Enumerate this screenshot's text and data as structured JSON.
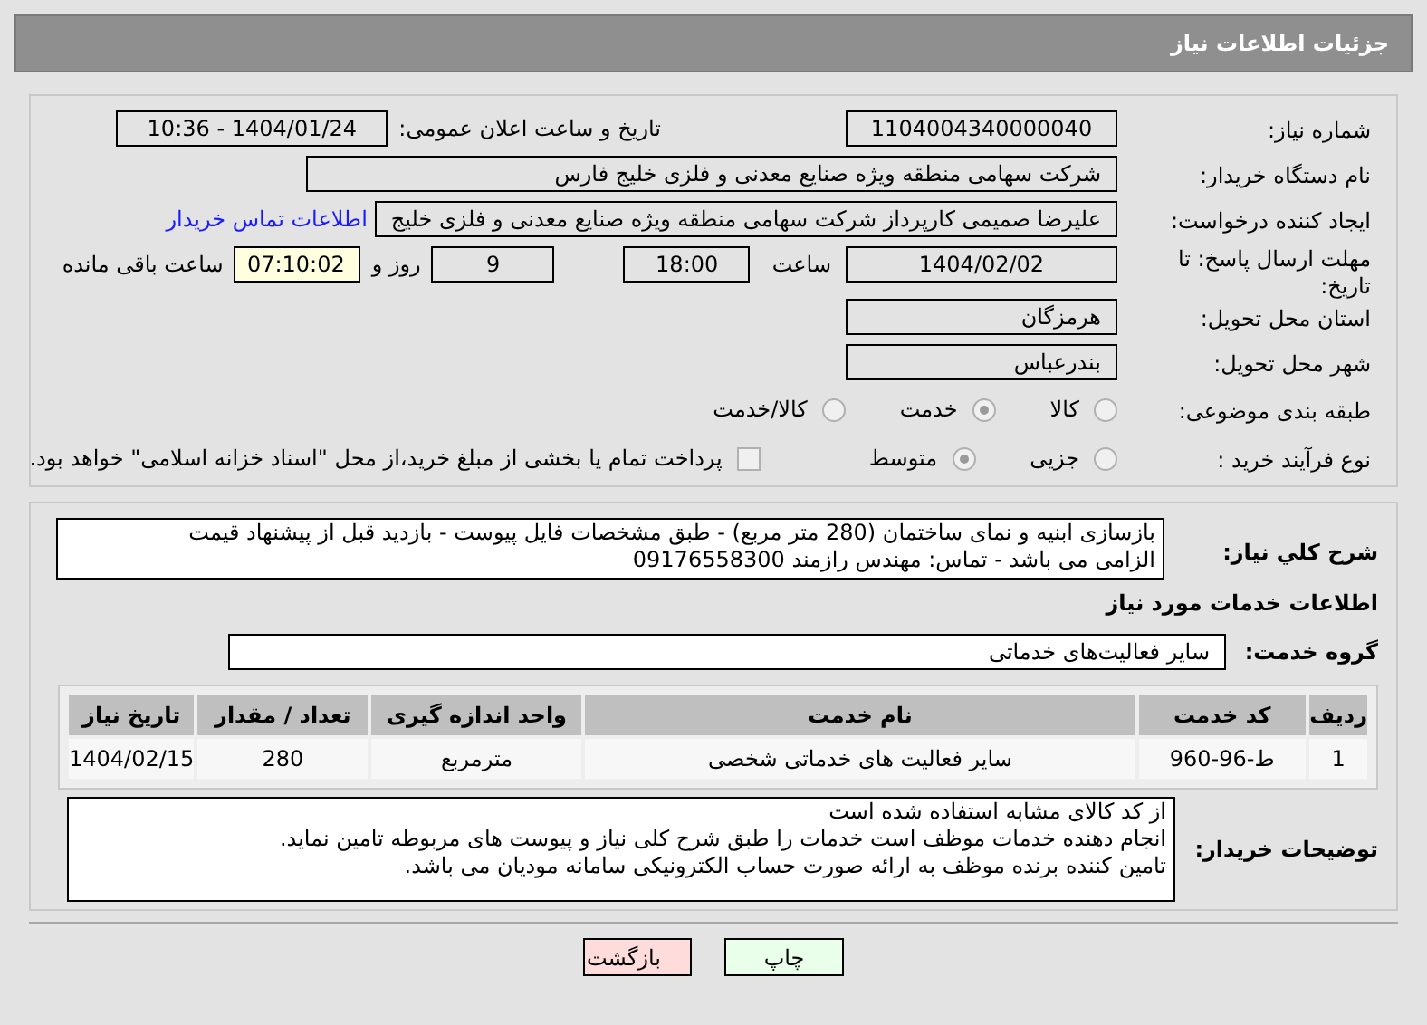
{
  "header": {
    "title": "جزئیات اطلاعات نیاز"
  },
  "need_number": {
    "label": "شماره نیاز:",
    "value": "1104004340000040"
  },
  "announce": {
    "label": "تاریخ و ساعت اعلان عمومی:",
    "value": "1404/01/24 - 10:36"
  },
  "buyer": {
    "label": "نام دستگاه خریدار:",
    "value": "شرکت سهامی منطقه ویژه صنایع معدنی و فلزی خلیج فارس"
  },
  "creator": {
    "label": "ایجاد کننده درخواست:",
    "value": "علیرضا صمیمی کارپرداز شرکت سهامی منطقه ویژه صنایع معدنی و فلزی خلیج",
    "link": "اطلاعات تماس خریدار"
  },
  "deadline": {
    "label": "مهلت ارسال پاسخ: تا تاریخ:",
    "date": "1404/02/02",
    "time_label": "ساعت",
    "time": "18:00",
    "days": "9",
    "days_label": "روز و",
    "remaining": "07:10:02",
    "remaining_label": "ساعت باقی مانده"
  },
  "province": {
    "label": "استان محل تحویل:",
    "value": "هرمزگان"
  },
  "city": {
    "label": "شهر محل تحویل:",
    "value": "بندرعباس"
  },
  "category": {
    "label": "طبقه بندی موضوعی:",
    "options": [
      {
        "label": "کالا",
        "selected": false
      },
      {
        "label": "خدمت",
        "selected": true
      },
      {
        "label": "کالا/خدمت",
        "selected": false
      }
    ]
  },
  "process": {
    "label": "نوع فرآیند خرید :",
    "options": [
      {
        "label": "جزیی",
        "selected": false
      },
      {
        "label": "متوسط",
        "selected": true
      }
    ],
    "treasury": {
      "checked": false,
      "label": "پرداخت تمام یا بخشی از مبلغ خرید،از محل \"اسناد خزانه اسلامی\" خواهد بود."
    }
  },
  "description": {
    "label": "شرح کلي نیاز:",
    "lines": [
      "بازسازی ابنیه و نمای ساختمان (280 متر مربع) - طبق مشخصات فایل پیوست - بازدید قبل از پیشنهاد قیمت",
      "الزامی می باشد - تماس: مهندس رازمند 09176558300"
    ]
  },
  "services_heading": "اطلاعات خدمات مورد نیاز",
  "service_group": {
    "label": "گروه خدمت:",
    "value": "سایر فعالیت‌های خدماتی"
  },
  "table": {
    "columns": [
      "ردیف",
      "کد خدمت",
      "نام خدمت",
      "واحد اندازه گیری",
      "تعداد / مقدار",
      "تاریخ نیاز"
    ],
    "rows": [
      [
        "1",
        "ط-96-960",
        "سایر فعالیت های خدماتی شخصی",
        "مترمربع",
        "280",
        "1404/02/15"
      ]
    ]
  },
  "buyer_notes": {
    "label": "توضیحات خریدار:",
    "lines": [
      "از کد کالای مشابه استفاده شده است",
      "انجام دهنده خدمات موظف است خدمات را طبق شرح کلی نیاز و پیوست های مربوطه تامین نماید.",
      "تامین کننده برنده موظف به ارائه صورت حساب الکترونیکی سامانه مودیان می باشد."
    ]
  },
  "buttons": [
    {
      "kind": "print",
      "label": "چاپ"
    },
    {
      "kind": "back",
      "label": "بازگشت"
    }
  ]
}
